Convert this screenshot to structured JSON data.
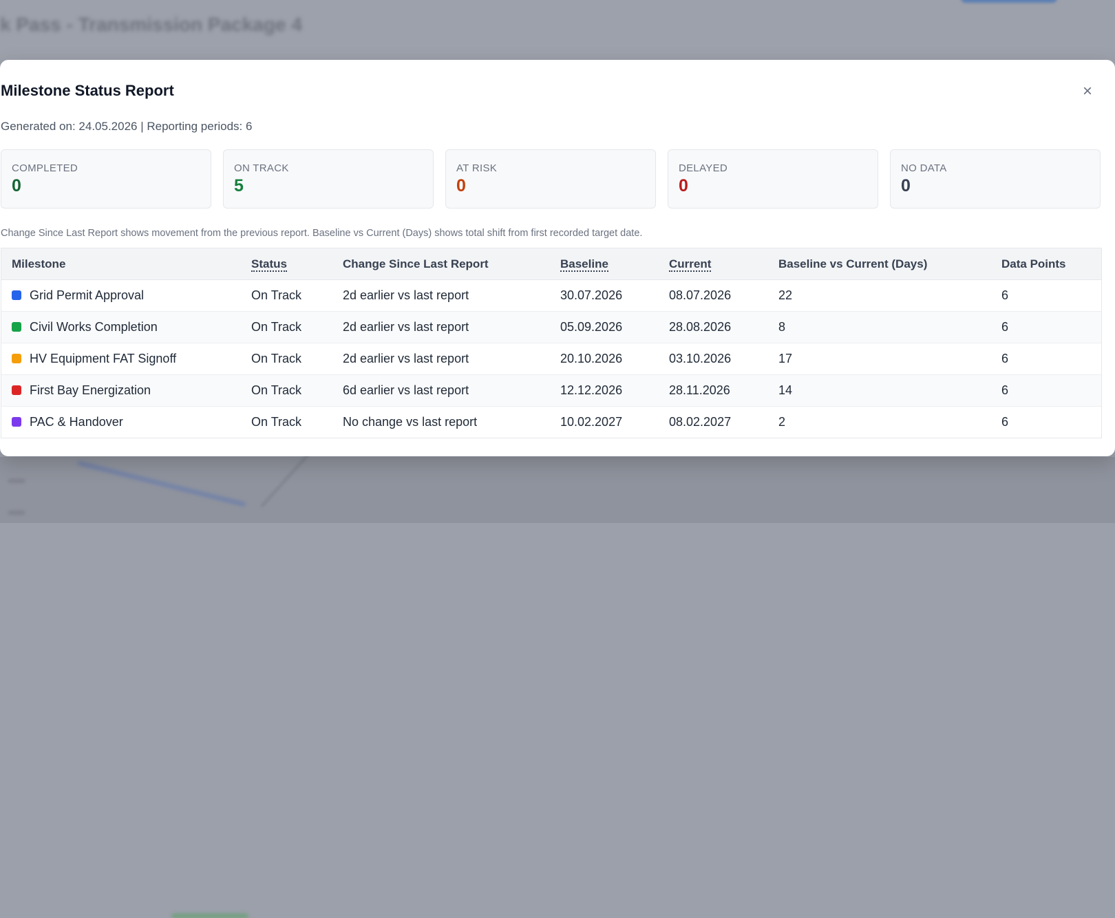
{
  "background": {
    "title": "k Pass - Transmission Package 4"
  },
  "modal": {
    "title": "Milestone Status Report",
    "close_label": "×",
    "meta": "Generated on: 24.05.2026 | Reporting periods: 6",
    "note": "Change Since Last Report shows movement from the previous report. Baseline vs Current (Days) shows total shift from first recorded target date."
  },
  "summary": [
    {
      "label": "COMPLETED",
      "value": "0",
      "color": "#166534"
    },
    {
      "label": "ON TRACK",
      "value": "5",
      "color": "#15803d"
    },
    {
      "label": "AT RISK",
      "value": "0",
      "color": "#c2410c"
    },
    {
      "label": "DELAYED",
      "value": "0",
      "color": "#b91c1c"
    },
    {
      "label": "NO DATA",
      "value": "0",
      "color": "#374151"
    }
  ],
  "table": {
    "headers": [
      "Milestone",
      "Status",
      "Change Since Last Report",
      "Baseline",
      "Current",
      "Baseline vs Current (Days)",
      "Data Points"
    ],
    "rows": [
      {
        "color": "#2563eb",
        "milestone": "Grid Permit Approval",
        "status": "On Track",
        "change": "2d earlier vs last report",
        "baseline": "30.07.2026",
        "current": "08.07.2026",
        "diff": "22",
        "points": "6"
      },
      {
        "color": "#16a34a",
        "milestone": "Civil Works Completion",
        "status": "On Track",
        "change": "2d earlier vs last report",
        "baseline": "05.09.2026",
        "current": "28.08.2026",
        "diff": "8",
        "points": "6"
      },
      {
        "color": "#f59e0b",
        "milestone": "HV Equipment FAT Signoff",
        "status": "On Track",
        "change": "2d earlier vs last report",
        "baseline": "20.10.2026",
        "current": "03.10.2026",
        "diff": "17",
        "points": "6"
      },
      {
        "color": "#dc2626",
        "milestone": "First Bay Energization",
        "status": "On Track",
        "change": "6d earlier vs last report",
        "baseline": "12.12.2026",
        "current": "28.11.2026",
        "diff": "14",
        "points": "6"
      },
      {
        "color": "#7c3aed",
        "milestone": "PAC & Handover",
        "status": "On Track",
        "change": "No change vs last report",
        "baseline": "10.02.2027",
        "current": "08.02.2027",
        "diff": "2",
        "points": "6"
      }
    ]
  }
}
